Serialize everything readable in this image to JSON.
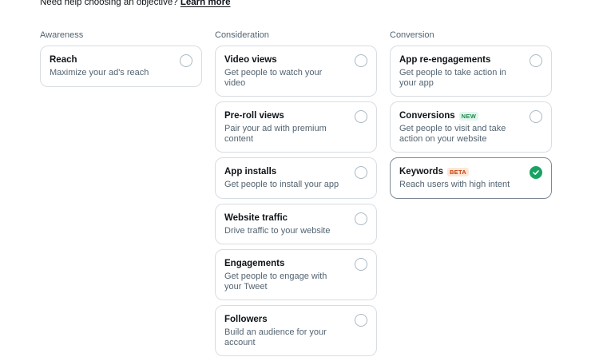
{
  "help": {
    "text": "Need help choosing an objective?",
    "link": "Learn more"
  },
  "columns": [
    {
      "label": "Awareness",
      "cards": [
        {
          "title": "Reach",
          "desc": "Maximize your ad's reach"
        }
      ]
    },
    {
      "label": "Consideration",
      "cards": [
        {
          "title": "Video views",
          "desc": "Get people to watch your video"
        },
        {
          "title": "Pre-roll views",
          "desc": "Pair your ad with premium content"
        },
        {
          "title": "App installs",
          "desc": "Get people to install your app"
        },
        {
          "title": "Website traffic",
          "desc": "Drive traffic to your website"
        },
        {
          "title": "Engagements",
          "desc": "Get people to engage with your Tweet"
        },
        {
          "title": "Followers",
          "desc": "Build an audience for your account"
        }
      ]
    },
    {
      "label": "Conversion",
      "cards": [
        {
          "title": "App re-engagements",
          "desc": "Get people to take action in your app"
        },
        {
          "title": "Conversions",
          "badge": "NEW",
          "desc": "Get people to visit and take action on your website"
        },
        {
          "title": "Keywords",
          "badge": "BETA",
          "desc": "Reach users with high intent",
          "selected": true
        }
      ]
    }
  ],
  "colors": {
    "selected_check": "#19a363",
    "badge_new": "#1a8a4f",
    "badge_beta": "#c2410c"
  }
}
